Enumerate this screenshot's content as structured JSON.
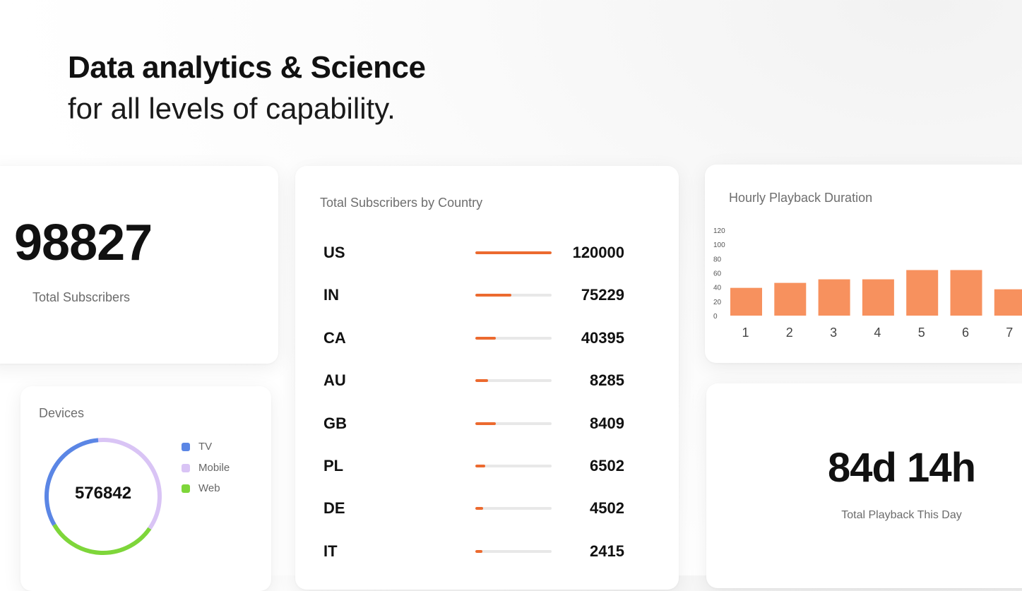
{
  "hero": {
    "title": "Data analytics & Science",
    "subtitle": "for all levels of capability."
  },
  "subscribers": {
    "value": "98827",
    "label": "Total Subscribers"
  },
  "country": {
    "title": "Total Subscribers by Country",
    "max": 120000,
    "accent": "#ec6a2f",
    "rows": [
      {
        "code": "US",
        "value": "120000",
        "share": 1.0
      },
      {
        "code": "IN",
        "value": "75229",
        "share": 0.47
      },
      {
        "code": "CA",
        "value": "40395",
        "share": 0.27
      },
      {
        "code": "AU",
        "value": "8285",
        "share": 0.17
      },
      {
        "code": "GB",
        "value": "8409",
        "share": 0.27
      },
      {
        "code": "PL",
        "value": "6502",
        "share": 0.13
      },
      {
        "code": "DE",
        "value": "4502",
        "share": 0.1
      },
      {
        "code": "IT",
        "value": "2415",
        "share": 0.09
      }
    ]
  },
  "devices": {
    "title": "Devices",
    "total": "576842",
    "legend": [
      {
        "label": "TV",
        "color": "#5b86e5",
        "icon": "square-dot-icon"
      },
      {
        "label": "Mobile",
        "color": "#d9c4f5",
        "icon": "square-dot-icon"
      },
      {
        "label": "Web",
        "color": "#7ed63a",
        "icon": "square-dot-icon"
      }
    ],
    "segments": [
      {
        "name": "TV",
        "fraction": 0.32,
        "color": "#5b86e5"
      },
      {
        "name": "Mobile",
        "fraction": 0.36,
        "color": "#d9c4f5"
      },
      {
        "name": "Web",
        "fraction": 0.32,
        "color": "#7ed63a"
      }
    ]
  },
  "playback": {
    "value": "84d 14h",
    "label": "Total Playback This Day"
  },
  "chart_data": {
    "type": "bar",
    "title": "Hourly Playback Duration",
    "xlabel": "",
    "ylabel": "",
    "categories": [
      "1",
      "2",
      "3",
      "4",
      "5",
      "6",
      "7"
    ],
    "values": [
      39,
      46,
      51,
      51,
      64,
      64,
      37
    ],
    "yticks": [
      "0",
      "20",
      "40",
      "60",
      "80",
      "100",
      "120"
    ],
    "ylim": [
      0,
      120
    ],
    "grid": false,
    "color": "#f7915e"
  }
}
